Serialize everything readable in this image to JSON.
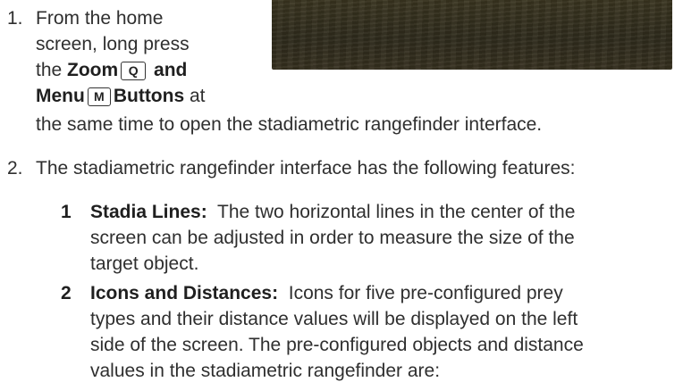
{
  "step1": {
    "number": "1.",
    "line1": "From the home",
    "line2": "screen, long press",
    "line3_pre": "the ",
    "zoom_label": "Zoom",
    "zoom_key": "Q",
    "and_label": " and",
    "menu_label": "Menu",
    "menu_key": "M",
    "buttons_label": "Buttons",
    "line4_post": " at",
    "line5": "the same time to open the stadiametric rangefinder interface."
  },
  "step2": {
    "number": "2.",
    "text": "The stadiametric rangefinder interface has the following features:",
    "features": [
      {
        "number": "1",
        "title": "Stadia Lines:",
        "line1": "The two horizontal lines in the center of the",
        "line2": "screen can be adjusted in order to measure the size of the",
        "line3": "target object."
      },
      {
        "number": "2",
        "title": "Icons and Distances:",
        "line1": "Icons for five pre-configured prey",
        "line2": "types and their distance values will be displayed on the left",
        "line3": "side of the screen. The pre-configured objects and distance",
        "line4": "values in the stadiametric rangefinder are:"
      }
    ]
  },
  "image": {
    "name": "device-photo",
    "colors": {
      "dark": "#2f2b1c",
      "mid": "#3a3520"
    }
  }
}
